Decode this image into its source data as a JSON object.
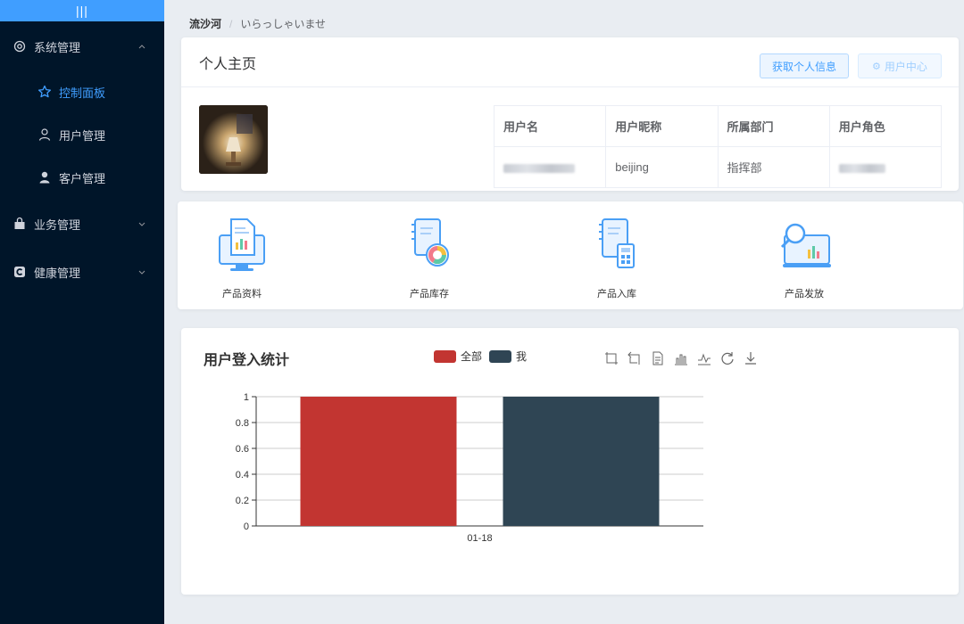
{
  "sidebar": {
    "toggle_label": "|||",
    "menus": [
      {
        "label": "系统管理",
        "icon": "settings-icon",
        "expanded": true,
        "children": [
          {
            "label": "控制面板",
            "icon": "star-icon",
            "active": true
          },
          {
            "label": "用户管理",
            "icon": "user-outline-icon",
            "active": false
          },
          {
            "label": "客户管理",
            "icon": "user-filled-icon",
            "active": false
          }
        ]
      },
      {
        "label": "业务管理",
        "icon": "shopping-bag-icon",
        "expanded": false
      },
      {
        "label": "健康管理",
        "icon": "health-icon",
        "expanded": false
      }
    ]
  },
  "breadcrumb": {
    "home": "流沙河",
    "separator": "/",
    "current": "いらっしゃいませ"
  },
  "profile": {
    "title": "个人主页",
    "get_info_button": "获取个人信息",
    "user_center_button": "用户中心",
    "table": {
      "headers": [
        "用户名",
        "用户昵称",
        "所属部门",
        "用户角色"
      ],
      "row": {
        "username": "",
        "nickname": "beijing",
        "department": "指挥部",
        "role": ""
      }
    }
  },
  "products": [
    {
      "label": "产品资料",
      "icon": "monitor-report-icon"
    },
    {
      "label": "产品库存",
      "icon": "notebook-pie-icon"
    },
    {
      "label": "产品入库",
      "icon": "notebook-calculator-icon"
    },
    {
      "label": "产品发放",
      "icon": "magnifier-chart-icon"
    }
  ],
  "chart_panel": {
    "title": "用户登入统计",
    "toolbox": [
      "zoom-icon",
      "zoom-reset-icon",
      "data-view-icon",
      "bar-chart-icon",
      "line-chart-icon",
      "restore-icon",
      "download-icon"
    ]
  },
  "chart_data": {
    "type": "bar",
    "categories": [
      "01-18"
    ],
    "series": [
      {
        "name": "全部",
        "values": [
          1
        ],
        "color": "#c23531"
      },
      {
        "name": "我",
        "values": [
          1
        ],
        "color": "#2f4554"
      }
    ],
    "yticks": [
      "0",
      "0.2",
      "0.4",
      "0.6",
      "0.8",
      "1"
    ],
    "ylim": [
      0,
      1
    ],
    "legend": "top",
    "grid": true
  }
}
